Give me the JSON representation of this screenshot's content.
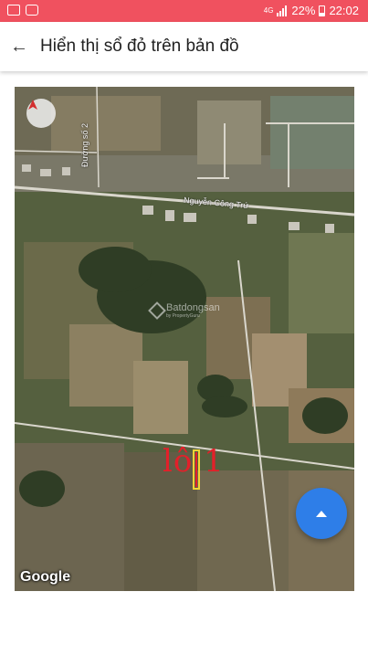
{
  "status_bar": {
    "network": "4G",
    "battery": "22%",
    "time": "22:02",
    "icons": [
      "gallery-icon",
      "chat-icon",
      "signal-icon",
      "battery-icon"
    ]
  },
  "app_bar": {
    "back_icon": "back-arrow-icon",
    "title": "Hiển thị sổ đỏ trên bản đồ"
  },
  "map": {
    "road_labels": [
      "Đường số 2",
      "Nguyễn Công Trứ"
    ],
    "watermark": {
      "brand": "Batdongsan",
      "sub": "by PropertyGuru"
    },
    "lot_label": "lô 1",
    "attribution": "Google",
    "compass_icon": "compass-icon"
  },
  "fab": {
    "icon": "chevron-up-icon"
  },
  "colors": {
    "status_bar": "#f0515f",
    "fab": "#2e7ee8",
    "lot_label": "#e3202a"
  }
}
